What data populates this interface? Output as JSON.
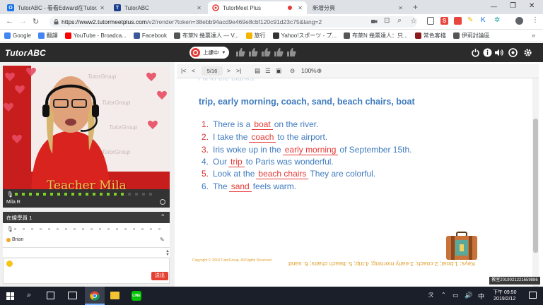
{
  "browser": {
    "tabs": [
      {
        "label": "TutorABC - 看看Edward在TutorA",
        "favicon_color": "#1a73e8",
        "favicon_text": "O"
      },
      {
        "label": "TutorABC",
        "favicon_color": "#1a3f8f",
        "favicon_text": "T"
      },
      {
        "label": "TutorMeet Plus",
        "favicon_color": "#e53935",
        "favicon_text": ""
      },
      {
        "label": "新增分頁",
        "favicon_color": "#ffffff",
        "favicon_text": ""
      }
    ],
    "url_host": "https://www2.tutormeetplus.com",
    "url_path": "/v2/render?token=38ebb94acd9e469e8cbf120c91d23c75&lang=2",
    "bookmarks": [
      {
        "label": "Google",
        "color": "#4285f4"
      },
      {
        "label": "翻譯",
        "color": "#4285f4"
      },
      {
        "label": "YouTube - Broadca...",
        "color": "#ff0000"
      },
      {
        "label": "Facebook",
        "color": "#3b5998"
      },
      {
        "label": "布萊N 幾票達人 — V...",
        "color": "#555555"
      },
      {
        "label": "旅行",
        "color": "#f4b400"
      },
      {
        "label": "Yahoo!スポーツ - プ...",
        "color": "#333333"
      },
      {
        "label": "布萊N 幾票達人：只...",
        "color": "#555555"
      },
      {
        "label": "常色客棧",
        "color": "#8b1a1a"
      },
      {
        "label": "伊莉討論區",
        "color": "#555555"
      }
    ]
  },
  "app": {
    "logo": "TutorABC",
    "status_label": "上課中",
    "teacher_name": "Teacher Mila",
    "video_user": "Mila R",
    "students_header": "在線學員 1",
    "student_name": "Brian",
    "send_label": "送出",
    "page_indicator": "5/16",
    "zoom": "100%"
  },
  "slide": {
    "word_bank": "trip, early morning, coach, sand, beach chairs, boat",
    "lines": [
      {
        "num": "1.",
        "before": "There is a",
        "answer": "boat",
        "after": "on the river.",
        "num_red": true
      },
      {
        "num": "2.",
        "before": "I take the",
        "answer": "coach",
        "after": "to the airport.",
        "num_red": true
      },
      {
        "num": "3.",
        "before": "Iris woke up in the",
        "answer": "early morning",
        "after": "of September 15th.",
        "num_red": true
      },
      {
        "num": "4.",
        "before": "Our",
        "answer": "trip",
        "after": "to Paris was wonderful.",
        "num_red": false
      },
      {
        "num": "5.",
        "before": "Look at the",
        "answer": "beach chairs",
        "after": "They are colorful.",
        "num_red": true
      },
      {
        "num": "6.",
        "before": "The",
        "answer": "sand",
        "after": "feels warm.",
        "num_red": false
      }
    ],
    "copyright": "Copyright © 2018 TutorGroup. All Rights Reserved",
    "keys": "Keys: 1.boat; 2.coach; 3.early morning; 4.trip; 5. beach chairs; 6. sand"
  },
  "tooltip": "教室2019021221659886",
  "taskbar": {
    "time": "下午 09:50",
    "date": "2019/2/12"
  }
}
